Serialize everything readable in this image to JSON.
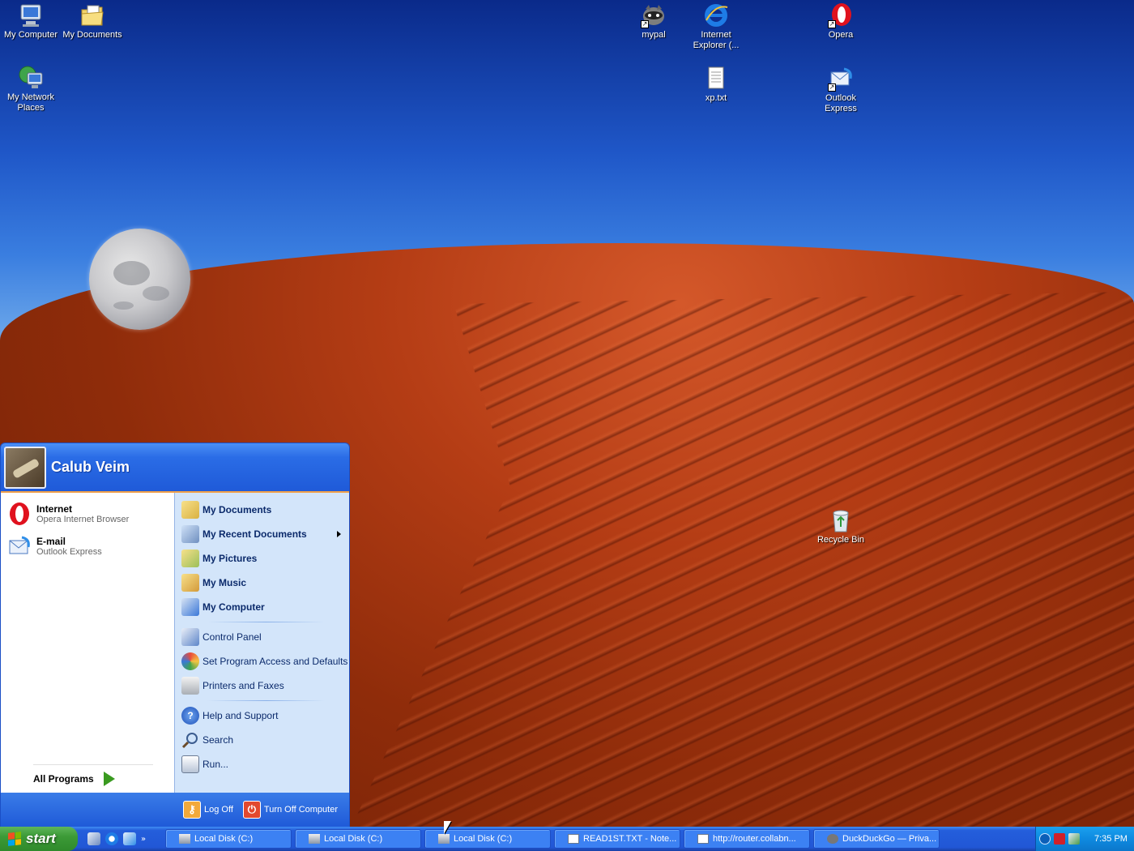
{
  "desktop": {
    "icons": [
      {
        "label": "My Computer",
        "icon": "my-computer-icon"
      },
      {
        "label": "My Documents",
        "icon": "my-documents-icon"
      },
      {
        "label": "My Network Places",
        "icon": "network-places-icon"
      },
      {
        "label": "mypal",
        "icon": "mypal-icon"
      },
      {
        "label": "Internet Explorer (...",
        "icon": "internet-explorer-icon"
      },
      {
        "label": "Opera",
        "icon": "opera-icon"
      },
      {
        "label": "xp.txt",
        "icon": "text-file-icon"
      },
      {
        "label": "Outlook Express",
        "icon": "outlook-express-icon"
      },
      {
        "label": "Recycle Bin",
        "icon": "recycle-bin-icon"
      }
    ]
  },
  "start_menu": {
    "user_name": "Calub Veim",
    "pinned": [
      {
        "title": "Internet",
        "subtitle": "Opera Internet Browser"
      },
      {
        "title": "E-mail",
        "subtitle": "Outlook Express"
      }
    ],
    "all_programs": "All Programs",
    "places": [
      "My Documents",
      "My Recent Documents",
      "My Pictures",
      "My Music",
      "My Computer"
    ],
    "system": [
      "Control Panel",
      "Set Program Access and Defaults",
      "Printers and Faxes"
    ],
    "tools": [
      "Help and Support",
      "Search",
      "Run..."
    ],
    "log_off": "Log Off",
    "turn_off": "Turn Off Computer"
  },
  "taskbar": {
    "start_label": "start",
    "tasks": [
      "Local Disk (C:)",
      "Local Disk (C:)",
      "Local Disk (C:)",
      "READ1ST.TXT - Note...",
      "http://router.collabn...",
      "DuckDuckGo — Priva..."
    ],
    "clock": "7:35 PM"
  }
}
